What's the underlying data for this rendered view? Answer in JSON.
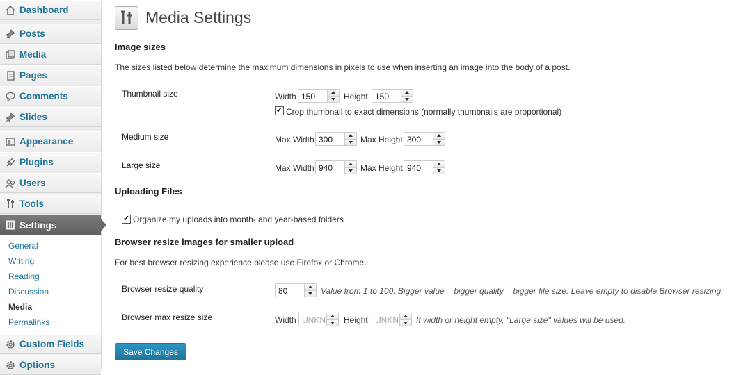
{
  "sidebar": {
    "items": [
      {
        "label": "Dashboard",
        "icon": "dashboard-icon"
      },
      {
        "label": "Posts",
        "icon": "pin-icon"
      },
      {
        "label": "Media",
        "icon": "media-icon"
      },
      {
        "label": "Pages",
        "icon": "pages-icon"
      },
      {
        "label": "Comments",
        "icon": "comment-icon"
      },
      {
        "label": "Slides",
        "icon": "pin-icon"
      },
      {
        "label": "Appearance",
        "icon": "appearance-icon"
      },
      {
        "label": "Plugins",
        "icon": "plugin-icon"
      },
      {
        "label": "Users",
        "icon": "users-icon"
      },
      {
        "label": "Tools",
        "icon": "tools-icon"
      },
      {
        "label": "Settings",
        "icon": "settings-icon"
      },
      {
        "label": "Custom Fields",
        "icon": "gear-icon"
      },
      {
        "label": "Options",
        "icon": "gear-icon"
      }
    ],
    "submenu": [
      "General",
      "Writing",
      "Reading",
      "Discussion",
      "Media",
      "Permalinks"
    ],
    "current_submenu": "Media"
  },
  "page": {
    "title": "Media Settings"
  },
  "image_sizes": {
    "heading": "Image sizes",
    "description": "The sizes listed below determine the maximum dimensions in pixels to use when inserting an image into the body of a post.",
    "thumbnail": {
      "label": "Thumbnail size",
      "width_label": "Width",
      "width": "150",
      "height_label": "Height",
      "height": "150",
      "crop_label": "Crop thumbnail to exact dimensions (normally thumbnails are proportional)",
      "crop_checked": true
    },
    "medium": {
      "label": "Medium size",
      "max_width_label": "Max Width",
      "max_width": "300",
      "max_height_label": "Max Height",
      "max_height": "300"
    },
    "large": {
      "label": "Large size",
      "max_width_label": "Max Width",
      "max_width": "940",
      "max_height_label": "Max Height",
      "max_height": "940"
    }
  },
  "uploading": {
    "heading": "Uploading Files",
    "organize_label": "Organize my uploads into month- and year-based folders",
    "organize_checked": true
  },
  "browser_resize": {
    "heading": "Browser resize images for smaller upload",
    "description": "For best browser resizing experience please use Firefox or Chrome.",
    "quality": {
      "label": "Browser resize quality",
      "value": "80",
      "hint": "Value from 1 to 100. Bigger value = bigger quality = bigger file size. Leave empty to disable Browser resizing."
    },
    "max_size": {
      "label": "Browser max resize size",
      "width_label": "Width",
      "width_placeholder": "UNKN",
      "height_label": "Height",
      "height_placeholder": "UNKN",
      "hint": "If width or height empty, \"Large size\" values will be used."
    }
  },
  "save_label": "Save Changes",
  "colors": {
    "link": "#21759b",
    "active_menu": "#6d6d6d",
    "button": "#21759b"
  }
}
